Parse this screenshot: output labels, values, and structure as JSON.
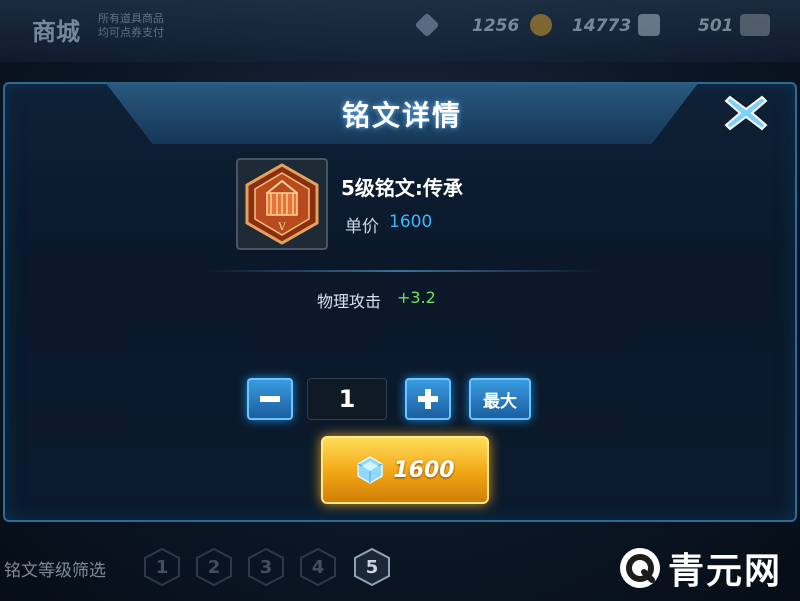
{
  "header": {
    "title": "商城",
    "subtitle_line1": "所有道具商品",
    "subtitle_line2": "均可点券支付",
    "currency": [
      {
        "value": "1256",
        "icon": "gem-icon"
      },
      {
        "value": "14773",
        "icon": "gold-coin-icon"
      },
      {
        "value": "501",
        "icon": "ticket-icon"
      }
    ]
  },
  "dialog": {
    "title": "铭文详情",
    "item_name": "5级铭文:传承",
    "price_label": "单价",
    "price_value": "1600",
    "attribute_label": "物理攻击",
    "attribute_value": "+3.2",
    "quantity": "1",
    "minus_label": "−",
    "plus_label": "+",
    "max_label": "最大",
    "buy_price": "1600"
  },
  "footer": {
    "filter_label": "铭文等级筛选",
    "levels": [
      "1",
      "2",
      "3",
      "4",
      "5"
    ],
    "active_level": "5",
    "watermark": "青元网"
  },
  "colors": {
    "accent_blue": "#3ab7ff",
    "attr_green": "#6ee35a",
    "gold": "#f1a514"
  }
}
